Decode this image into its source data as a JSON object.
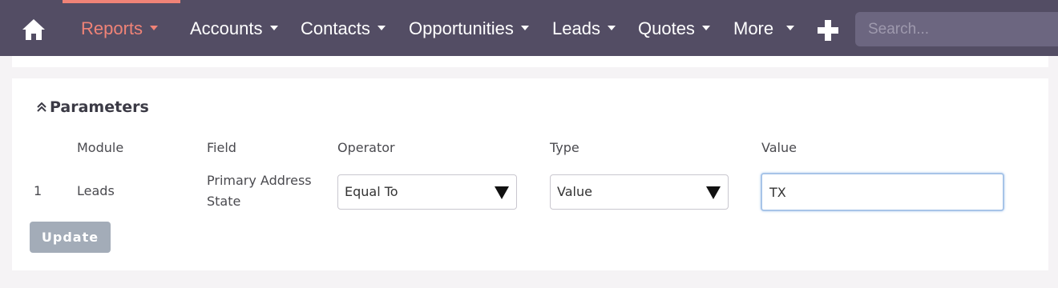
{
  "nav": {
    "home_icon": "home-icon",
    "items": [
      {
        "label": "Reports",
        "active": true
      },
      {
        "label": "Accounts"
      },
      {
        "label": "Contacts"
      },
      {
        "label": "Opportunities"
      },
      {
        "label": "Leads"
      },
      {
        "label": "Quotes"
      },
      {
        "label": "More"
      }
    ],
    "plus_icon": "plus-icon",
    "search_placeholder": "Search...",
    "colors": {
      "bar": "#534d64",
      "active": "#f08377",
      "search_bg": "#6c6680"
    }
  },
  "parameters": {
    "title": "Parameters",
    "toggle_icon": "double-chevron-up-icon",
    "headers": {
      "module": "Module",
      "field": "Field",
      "operator": "Operator",
      "type": "Type",
      "value": "Value"
    },
    "rows": [
      {
        "index": "1",
        "module": "Leads",
        "field_line1": "Primary Address",
        "field_line2": "State",
        "operator": "Equal To",
        "type": "Value",
        "value": "TX"
      }
    ],
    "update_label": "Update"
  }
}
